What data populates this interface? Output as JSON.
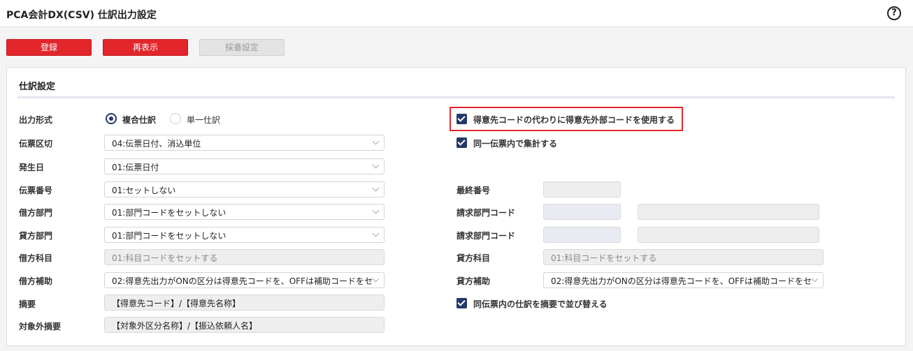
{
  "header": {
    "title": "PCA会計DX(CSV) 仕訳出力設定",
    "help_glyph": "?"
  },
  "toolbar": {
    "register_label": "登録",
    "refresh_label": "再表示",
    "numbering_label": "採番設定"
  },
  "section": {
    "title": "仕訳設定"
  },
  "left": {
    "output_format": {
      "label": "出力形式",
      "options": [
        "複合仕訳",
        "単一仕訳"
      ],
      "selected": "複合仕訳"
    },
    "slip_division": {
      "label": "伝票区切",
      "value": "04:伝票日付、消込単位"
    },
    "occurrence_date": {
      "label": "発生日",
      "value": "01:伝票日付"
    },
    "slip_number": {
      "label": "伝票番号",
      "value": "01:セットしない"
    },
    "debit_dept": {
      "label": "借方部門",
      "value": "01:部門コードをセットしない"
    },
    "credit_dept": {
      "label": "貸方部門",
      "value": "01:部門コードをセットしない"
    },
    "debit_account": {
      "label": "借方科目",
      "value": "01:科目コードをセットする"
    },
    "debit_sub": {
      "label": "借方補助",
      "value": "02:得意先出力がONの区分は得意先コードを、OFFは補助コードをセ"
    },
    "summary": {
      "label": "摘要",
      "value": "【得意先コード】/【得意先名称】"
    },
    "excluded_summary": {
      "label": "対象外摘要",
      "value": "【対象外区分名称】/【振込依頼人名】"
    }
  },
  "right": {
    "use_external_code": {
      "label": "得意先コードの代わりに得意先外部コードを使用する",
      "checked": true
    },
    "aggregate_in_slip": {
      "label": "同一伝票内で集計する",
      "checked": true
    },
    "last_number": {
      "label": "最終番号",
      "value": ""
    },
    "billing_dept_1": {
      "label": "請求部門コード",
      "code": "",
      "name": ""
    },
    "billing_dept_2": {
      "label": "請求部門コード",
      "code": "",
      "name": ""
    },
    "credit_account": {
      "label": "貸方科目",
      "value": "01:科目コードをセットする"
    },
    "credit_sub": {
      "label": "貸方補助",
      "value": "02:得意先出力がONの区分は得意先コードを、OFFは補助コードをセ"
    },
    "sort_by_summary": {
      "label": "同伝票内の仕訳を摘要で並び替える",
      "checked": true
    }
  },
  "colors": {
    "accent_red": "#e2262b",
    "check_navy": "#23396b"
  }
}
